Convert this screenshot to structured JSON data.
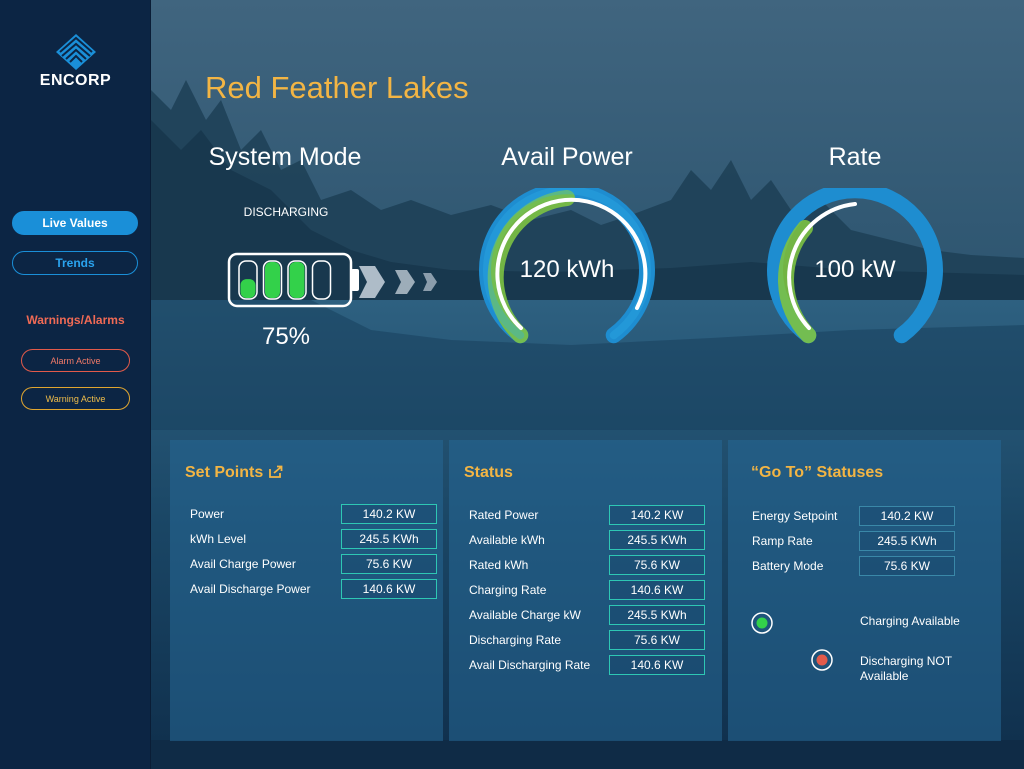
{
  "sidebar": {
    "logo_text": "ENCORP",
    "nav": [
      {
        "label": "Live Values",
        "active": true
      },
      {
        "label": "Trends",
        "active": false
      }
    ],
    "warnings_heading": "Warnings/Alarms",
    "alarm_label": "Alarm Active",
    "warning_label": "Warning Active"
  },
  "header": {
    "site_name": "Red Feather Lakes"
  },
  "system_mode": {
    "title": "System Mode",
    "mode": "DISCHARGING",
    "charge_percent_label": "75%",
    "charge_level": 0.75
  },
  "avail_power": {
    "title": "Avail Power",
    "value": "120 kWh"
  },
  "rate": {
    "title": "Rate",
    "value": "100 kW"
  },
  "set_points": {
    "title": "Set Points",
    "rows": [
      {
        "label": "Power",
        "value": "140.2 KW"
      },
      {
        "label": "kWh Level",
        "value": "245.5 KWh"
      },
      {
        "label": "Avail Charge Power",
        "value": "75.6 KW"
      },
      {
        "label": "Avail Discharge Power",
        "value": "140.6 KW"
      }
    ]
  },
  "status": {
    "title": "Status",
    "rows": [
      {
        "label": "Rated Power",
        "value": "140.2 KW"
      },
      {
        "label": "Available kWh",
        "value": "245.5 KWh"
      },
      {
        "label": "Rated kWh",
        "value": "75.6 KW"
      },
      {
        "label": "Charging Rate",
        "value": "140.6 KW"
      },
      {
        "label": "Available Charge kW",
        "value": "245.5 KWh"
      },
      {
        "label": "Discharging Rate",
        "value": "75.6 KW"
      },
      {
        "label": "Avail Discharging Rate",
        "value": "140.6 KW"
      }
    ]
  },
  "goto_statuses": {
    "title": "“Go To” Statuses",
    "rows": [
      {
        "label": "Energy Setpoint",
        "value": "140.2 KW"
      },
      {
        "label": "Ramp Rate",
        "value": "245.5 KWh"
      },
      {
        "label": "Battery Mode",
        "value": "75.6 KW"
      }
    ],
    "charging_label": "Charging Available",
    "discharging_label_line1": "Discharging NOT",
    "discharging_label_line2": "Available"
  },
  "colors": {
    "accent_gold": "#f3b544",
    "primary_blue": "#1a8fd8",
    "alarm_red": "#e25a4a",
    "warning_amber": "#e0a630",
    "ok_green": "#33d14a",
    "field_border": "#2ec7b4"
  }
}
